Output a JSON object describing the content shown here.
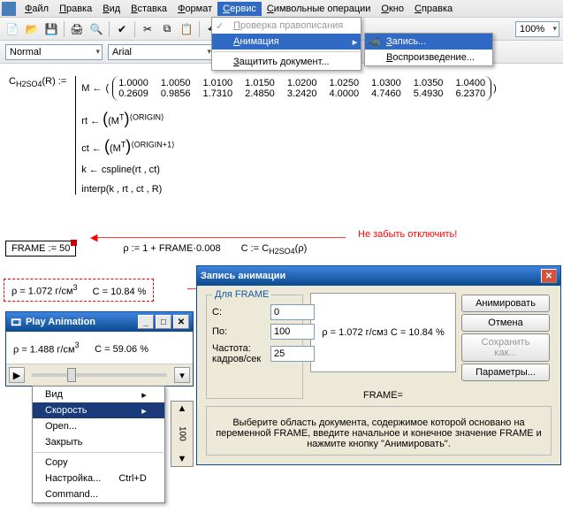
{
  "menubar": {
    "items": [
      "Файл",
      "Правка",
      "Вид",
      "Вставка",
      "Формат",
      "Сервис",
      "Символьные операции",
      "Окно",
      "Справка"
    ],
    "active": 5
  },
  "toolbar": {
    "zoom": "100%"
  },
  "fmtbar": {
    "style": "Normal",
    "font": "Arial"
  },
  "dd_service": {
    "items": [
      {
        "label": "Проверка правописания",
        "disabled": true,
        "ico": "✓"
      },
      {
        "label": "Анимация",
        "hl": true,
        "arrow": true
      },
      {
        "sep": true
      },
      {
        "label": "Защитить документ..."
      }
    ]
  },
  "dd_anim": {
    "items": [
      {
        "label": "Запись...",
        "hl": true,
        "ico": "📹"
      },
      {
        "label": "Воспроизведение..."
      }
    ]
  },
  "ws": {
    "lhs": "C",
    "lhs_sub": "H2SO4",
    "lhs_arg": "(R) :=",
    "m_assign": "M ←",
    "mat_r1": [
      "1.0000",
      "1.0050",
      "1.0100",
      "1.0150",
      "1.0200",
      "1.0250",
      "1.0300",
      "1.0350",
      "1.0400"
    ],
    "mat_r2": [
      "0.2609",
      "0.9856",
      "1.7310",
      "2.4850",
      "3.2420",
      "4.0000",
      "4.7460",
      "5.4930",
      "6.2370"
    ],
    "rt": "rt ←",
    "rt_body": "(M",
    "rt_sup": "T",
    "rt_close": ")",
    "rt_idx": "⟨ORIGIN⟩",
    "ct": "ct ←",
    "ct_body": "(M",
    "ct_sup": "T",
    "ct_close": ")",
    "ct_idx": "⟨ORIGIN+1⟩",
    "k": "k ← cspline(rt , ct)",
    "interp": "interp(k , rt , ct , R)"
  },
  "frame_box": "FRAME := 50",
  "rho_def": "ρ := 1 + FRAME·0.008",
  "c_def_a": "C := C",
  "c_def_sub": "H2SO4",
  "c_def_b": "(ρ)",
  "red_note": "Не забыть отключить!",
  "results": {
    "rho": "ρ = 1.072 г/см",
    "rho_sup": "3",
    "c": "C = 10.84 %"
  },
  "playwin": {
    "title": "Play Animation",
    "rho": "ρ = 1.488 г/см",
    "rho_sup": "3",
    "c": "C = 59.06 %"
  },
  "ctx": {
    "items": [
      {
        "label": "Вид",
        "arrow": true
      },
      {
        "label": "Скорость",
        "arrow": true,
        "hl": true
      },
      {
        "label": "Open..."
      },
      {
        "label": "Закрыть"
      },
      {
        "sep": true
      },
      {
        "label": "Copy"
      },
      {
        "label": "Настройка...",
        "sc": "Ctrl+D"
      },
      {
        "label": "Command..."
      }
    ]
  },
  "zoombar": {
    "up": "▲",
    "val": "100",
    "down": "▼"
  },
  "dlg": {
    "title": "Запись анимации",
    "group": "Для FRAME",
    "from_l": "С:",
    "from_v": "0",
    "to_l": "По:",
    "to_v": "100",
    "rate_l": "Частота: кадров/сек",
    "rate_v": "25",
    "preview": {
      "rho": "ρ = 1.072 г/см",
      "rho_sup": "3",
      "c": "C = 10.84 %",
      "frame": "FRAME="
    },
    "btn_anim": "Анимировать",
    "btn_cancel": "Отмена",
    "btn_save": "Сохранить как...",
    "btn_opts": "Параметры...",
    "help": "Выберите область документа, содержимое которой основано на переменной FRAME, введите начальное и конечное значение FRAME и нажмите кнопку \"Анимировать\"."
  }
}
